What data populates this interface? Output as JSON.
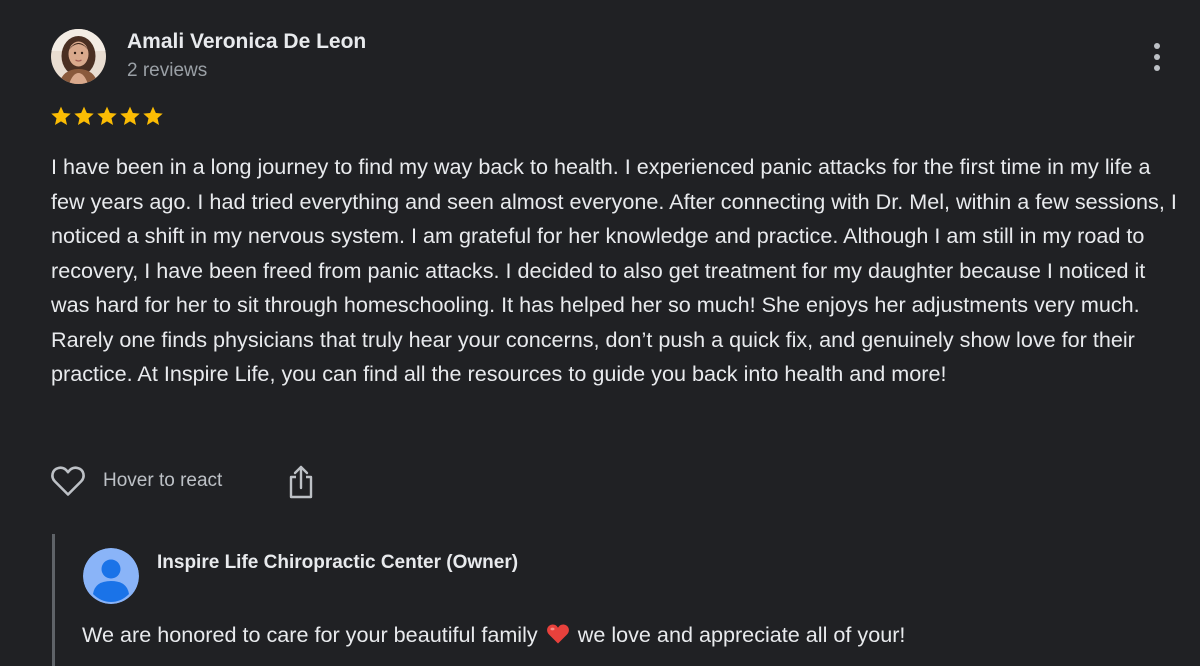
{
  "review": {
    "reviewer_name": "Amali Veronica De Leon",
    "reviewer_meta": "2 reviews",
    "rating": 5,
    "rating_max": 5,
    "star_color": "#fbbc04",
    "text": "I have been in a long journey to find my way back to health. I experienced panic attacks for the first time in my life a few years ago. I had tried everything and seen almost everyone. After connecting with Dr. Mel, within a few sessions, I noticed a shift in my nervous system. I am grateful for her knowledge and practice. Although I am still in my road to recovery, I have been freed from panic attacks. I decided to also get treatment for my daughter because I noticed it was hard for her to sit through homeschooling. It has helped her so much! She enjoys her adjustments very much. Rarely one finds physicians that truly hear your concerns, don’t push a quick fix, and genuinely show love for their practice. At Inspire Life, you can find all the resources to guide you back into health and more!",
    "icons": {
      "more": "more-vert-icon",
      "react": "heart-outline-icon",
      "share": "share-icon"
    }
  },
  "actions": {
    "react_label": "Hover to react"
  },
  "owner_reply": {
    "name": "Inspire Life Chiropractic Center (Owner)",
    "text_before_emoji": "We are honored to care for your beautiful family",
    "emoji": "red-heart-emoji",
    "text_after_emoji": "we love and appreciate all of your!",
    "avatar_color": "#8ab4f8"
  },
  "colors": {
    "background": "#202124",
    "primary_text": "#e8eaed",
    "secondary_text": "#9aa0a6",
    "reply_border": "#5f6368"
  }
}
